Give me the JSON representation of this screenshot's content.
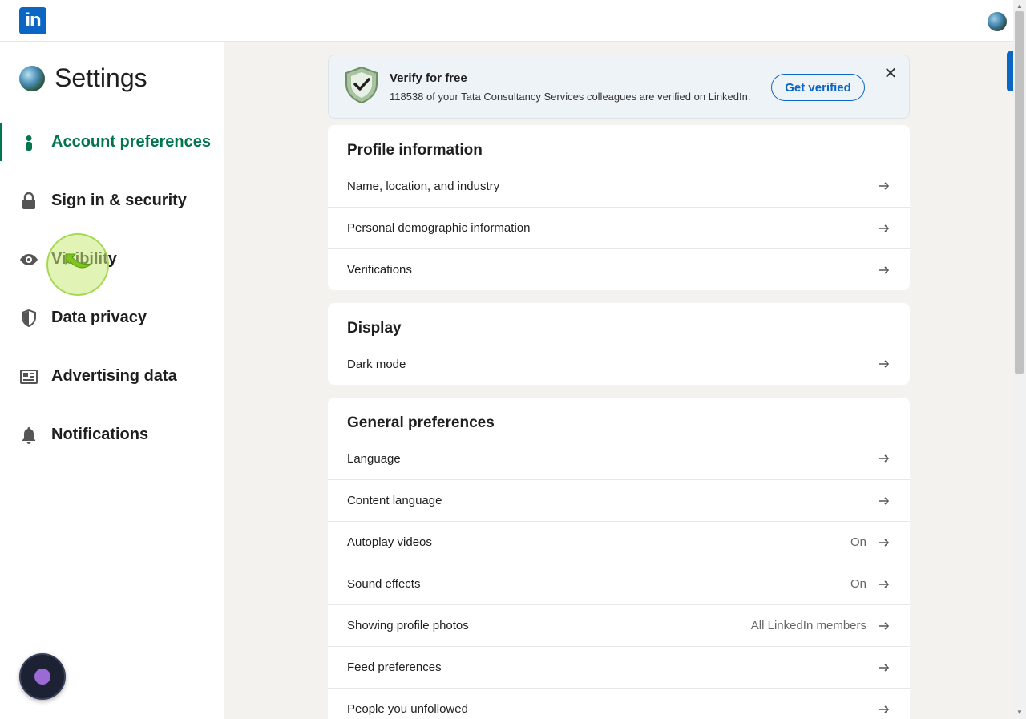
{
  "header": {
    "logo_text": "in"
  },
  "sidebar": {
    "title": "Settings",
    "items": [
      {
        "label": "Account preferences",
        "icon": "person-icon",
        "active": true
      },
      {
        "label": "Sign in & security",
        "icon": "lock-icon"
      },
      {
        "label": "Visibility",
        "icon": "eye-icon"
      },
      {
        "label": "Data privacy",
        "icon": "shield-icon"
      },
      {
        "label": "Advertising data",
        "icon": "newspaper-icon"
      },
      {
        "label": "Notifications",
        "icon": "bell-icon"
      }
    ]
  },
  "banner": {
    "title": "Verify for free",
    "subtitle": "118538 of your Tata Consultancy Services colleagues are verified on LinkedIn.",
    "button": "Get verified",
    "close": "✕"
  },
  "sections": {
    "profile": {
      "title": "Profile information",
      "rows": [
        "Name, location, and industry",
        "Personal demographic information",
        "Verifications"
      ]
    },
    "display": {
      "title": "Display",
      "rows": [
        "Dark mode"
      ]
    },
    "general": {
      "title": "General preferences",
      "rows": [
        {
          "label": "Language",
          "value": ""
        },
        {
          "label": "Content language",
          "value": ""
        },
        {
          "label": "Autoplay videos",
          "value": "On"
        },
        {
          "label": "Sound effects",
          "value": "On"
        },
        {
          "label": "Showing profile photos",
          "value": "All LinkedIn members"
        },
        {
          "label": "Feed preferences",
          "value": ""
        },
        {
          "label": "People you unfollowed",
          "value": ""
        }
      ]
    }
  },
  "colors": {
    "brand": "#0a66c2",
    "active_green": "#01754f",
    "background": "#f4f2ee"
  }
}
